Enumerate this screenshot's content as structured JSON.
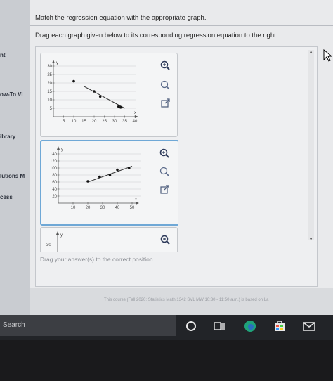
{
  "sidebar": {
    "items": [
      {
        "label": "nt"
      },
      {
        "label": "ow-To Vi"
      },
      {
        "label": "ibrary"
      },
      {
        "label": "lutions M"
      },
      {
        "label": "cess"
      }
    ]
  },
  "question": {
    "title": "Match the regression equation with the appropriate graph.",
    "instruction": "Drag each graph given below to its corresponding regression equation to the right.",
    "drop_hint": "Drag your answer(s) to the correct position."
  },
  "graph1": {
    "y_label": "y",
    "x_label": "x",
    "y_ticks": [
      "30",
      "25",
      "20",
      "15",
      "10",
      "5"
    ],
    "x_ticks": [
      "5",
      "10",
      "15",
      "20",
      "25",
      "30",
      "35",
      "40"
    ],
    "points": [
      [
        10,
        21
      ],
      [
        20,
        15
      ],
      [
        23,
        12
      ],
      [
        32,
        6
      ],
      [
        33,
        5.5
      ]
    ],
    "line": [
      [
        15,
        18
      ],
      [
        35,
        5
      ]
    ]
  },
  "graph2": {
    "y_label": "y",
    "x_label": "x",
    "y_ticks": [
      "140",
      "120",
      "100",
      "80",
      "60",
      "40",
      "20"
    ],
    "x_ticks": [
      "10",
      "20",
      "30",
      "40",
      "50"
    ],
    "points": [
      [
        20,
        62
      ],
      [
        28,
        75
      ],
      [
        35,
        80
      ],
      [
        40,
        95
      ],
      [
        48,
        100
      ]
    ],
    "line": [
      [
        20,
        60
      ],
      [
        50,
        105
      ]
    ]
  },
  "graph3": {
    "y_label": "y",
    "y_ticks": [
      "30"
    ]
  },
  "footer": {
    "text": "This course (Fall 2020: Statistics Math 1342 SVL MW 10:30 - 11:50 a.m.) is based on La"
  },
  "taskbar": {
    "search_label": "Search"
  },
  "colors": {
    "selected_border": "#6fa8d6",
    "point": "#111111"
  }
}
